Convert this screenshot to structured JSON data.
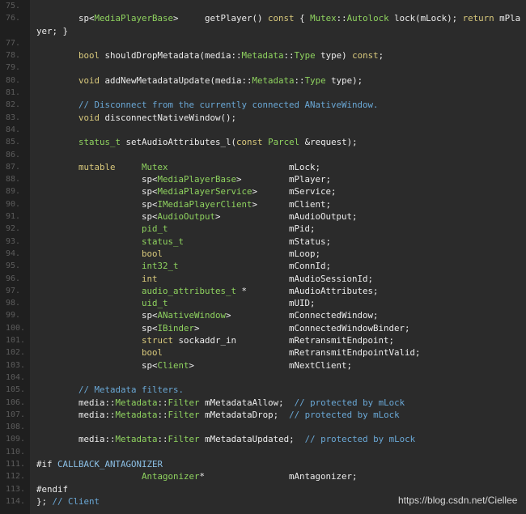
{
  "editor": {
    "colors": {
      "background": "#2b2b2b",
      "gutter": "#1f1f1f",
      "keyword": "#d9c97c",
      "type": "#8fd35f",
      "comment": "#6aa8d6",
      "line_number": "#5c5c5c"
    },
    "keywords": [
      "bool",
      "void",
      "const",
      "mutable",
      "struct",
      "return",
      "int"
    ],
    "types": [
      "MediaPlayerBase",
      "Mutex",
      "Autolock",
      "Metadata",
      "Type",
      "status_t",
      "Parcel",
      "MediaPlayerService",
      "IMediaPlayerClient",
      "AudioOutput",
      "pid_t",
      "int32_t",
      "audio_attributes_t",
      "uid_t",
      "ANativeWindow",
      "IBinder",
      "Client",
      "Filter",
      "Antagonizer"
    ],
    "lines": [
      {
        "n": "75.",
        "cells": []
      },
      {
        "n": "76.",
        "cells": [
          "",
          "sp<MediaPlayerBase>     getPlayer() const { Mutex::Autolock lock(mLock); return mPla"
        ]
      },
      {
        "n": "",
        "cells": [
          "yer; }"
        ]
      },
      {
        "n": "77.",
        "cells": []
      },
      {
        "n": "78.",
        "cells": [
          "",
          "bool shouldDropMetadata(media::Metadata::Type type) const;"
        ]
      },
      {
        "n": "79.",
        "cells": []
      },
      {
        "n": "80.",
        "cells": [
          "",
          "void addNewMetadataUpdate(media::Metadata::Type type);"
        ]
      },
      {
        "n": "81.",
        "cells": []
      },
      {
        "n": "82.",
        "cells": [
          "",
          "// Disconnect from the currently connected ANativeWindow."
        ]
      },
      {
        "n": "83.",
        "cells": [
          "",
          "void disconnectNativeWindow();"
        ]
      },
      {
        "n": "84.",
        "cells": []
      },
      {
        "n": "85.",
        "cells": [
          "",
          "status_t setAudioAttributes_l(const Parcel &request);"
        ]
      },
      {
        "n": "86.",
        "cells": []
      },
      {
        "n": "87.",
        "cells": [
          "",
          "mutable",
          "Mutex",
          "mLock;"
        ]
      },
      {
        "n": "88.",
        "cells": [
          "",
          "",
          "sp<MediaPlayerBase>",
          "mPlayer;"
        ]
      },
      {
        "n": "89.",
        "cells": [
          "",
          "",
          "sp<MediaPlayerService>",
          "mService;"
        ]
      },
      {
        "n": "90.",
        "cells": [
          "",
          "",
          "sp<IMediaPlayerClient>",
          "mClient;"
        ]
      },
      {
        "n": "91.",
        "cells": [
          "",
          "",
          "sp<AudioOutput>",
          "mAudioOutput;"
        ]
      },
      {
        "n": "92.",
        "cells": [
          "",
          "",
          "pid_t",
          "mPid;"
        ]
      },
      {
        "n": "93.",
        "cells": [
          "",
          "",
          "status_t",
          "mStatus;"
        ]
      },
      {
        "n": "94.",
        "cells": [
          "",
          "",
          "bool",
          "mLoop;"
        ]
      },
      {
        "n": "95.",
        "cells": [
          "",
          "",
          "int32_t",
          "mConnId;"
        ]
      },
      {
        "n": "96.",
        "cells": [
          "",
          "",
          "int",
          "mAudioSessionId;"
        ]
      },
      {
        "n": "97.",
        "cells": [
          "",
          "",
          "audio_attributes_t *",
          "mAudioAttributes;"
        ]
      },
      {
        "n": "98.",
        "cells": [
          "",
          "",
          "uid_t",
          "mUID;"
        ]
      },
      {
        "n": "99.",
        "cells": [
          "",
          "",
          "sp<ANativeWindow>",
          "mConnectedWindow;"
        ]
      },
      {
        "n": "100.",
        "cells": [
          "",
          "",
          "sp<IBinder>",
          "mConnectedWindowBinder;"
        ]
      },
      {
        "n": "101.",
        "cells": [
          "",
          "",
          "struct sockaddr_in",
          "mRetransmitEndpoint;"
        ]
      },
      {
        "n": "102.",
        "cells": [
          "",
          "",
          "bool",
          "mRetransmitEndpointValid;"
        ]
      },
      {
        "n": "103.",
        "cells": [
          "",
          "",
          "sp<Client>",
          "mNextClient;"
        ]
      },
      {
        "n": "104.",
        "cells": []
      },
      {
        "n": "105.",
        "cells": [
          "",
          "// Metadata filters."
        ]
      },
      {
        "n": "106.",
        "cells": [
          "",
          "media::Metadata::Filter mMetadataAllow;  // protected by mLock"
        ]
      },
      {
        "n": "107.",
        "cells": [
          "",
          "media::Metadata::Filter mMetadataDrop;  // protected by mLock"
        ]
      },
      {
        "n": "108.",
        "cells": []
      },
      {
        "n": "109.",
        "cells": [
          "",
          "media::Metadata::Filter mMetadataUpdated;  // protected by mLock"
        ]
      },
      {
        "n": "110.",
        "cells": []
      },
      {
        "n": "111.",
        "cells": [
          "#if CALLBACK_ANTAGONIZER"
        ]
      },
      {
        "n": "112.",
        "cells": [
          "",
          "",
          "Antagonizer*",
          "mAntagonizer;"
        ]
      },
      {
        "n": "113.",
        "cells": [
          "#endif"
        ]
      },
      {
        "n": "114.",
        "cells": [
          "}; // Client"
        ]
      }
    ]
  },
  "watermark": "https://blog.csdn.net/Ciellee"
}
